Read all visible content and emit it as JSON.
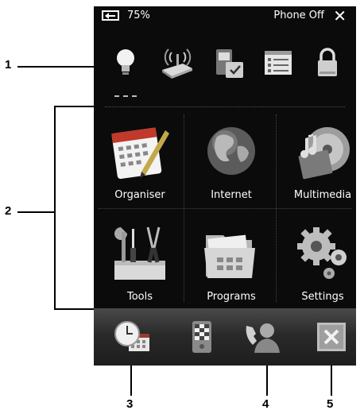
{
  "callouts": [
    "1",
    "2",
    "3",
    "4",
    "5"
  ],
  "status_bar": {
    "battery_icon": "battery-icon",
    "battery_level": "75%",
    "phone_status": "Phone Off",
    "close_symbol": "✕"
  },
  "quick_icons": [
    "lightbulb-icon",
    "wireless-icon",
    "sim-phone-icon",
    "list-menu-icon",
    "lock-icon"
  ],
  "tiles": [
    {
      "label": "Organiser",
      "icon": "calendar-pen-icon"
    },
    {
      "label": "Internet",
      "icon": "globe-icon"
    },
    {
      "label": "Multimedia",
      "icon": "media-disc-icon"
    },
    {
      "label": "Tools",
      "icon": "tools-icon"
    },
    {
      "label": "Programs",
      "icon": "folder-icon"
    },
    {
      "label": "Settings",
      "icon": "gears-icon"
    }
  ],
  "bottom_bar": {
    "icons": [
      "clock-calendar-icon",
      "phone-device-icon",
      "call-person-icon",
      "close-box-icon"
    ]
  }
}
